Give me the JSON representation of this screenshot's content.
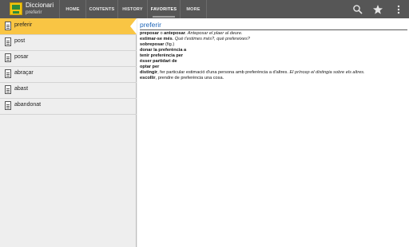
{
  "app": {
    "title": "Diccionari",
    "subtitle": "preferir"
  },
  "tabs": [
    {
      "label": "HOME"
    },
    {
      "label": "CONTENTS"
    },
    {
      "label": "HISTORY"
    },
    {
      "label": "FAVORITES"
    },
    {
      "label": "MORE"
    }
  ],
  "active_tab": "FAVORITES",
  "action_icons": [
    "search-icon",
    "star-icon",
    "overflow-menu-icon"
  ],
  "colors": {
    "action_bar": "#565656",
    "selected_row": "#f9c544",
    "entry_title": "#1f66b8"
  },
  "favorites": [
    {
      "word": "preferir",
      "selected": true
    },
    {
      "word": "post",
      "selected": false
    },
    {
      "word": "posar",
      "selected": false
    },
    {
      "word": "abraçar",
      "selected": false
    },
    {
      "word": "abast",
      "selected": false
    },
    {
      "word": "abandonat",
      "selected": false
    }
  ],
  "entry": {
    "headword": "preferir",
    "lines": [
      {
        "bold": "preposar",
        "text": " o ",
        "bold2": "anteposar",
        "italic": ". Anteposar el plaer al deure."
      },
      {
        "bold": "estimar-se més",
        "text": ". ",
        "bold2": "",
        "italic": "Què t'estimes més?, què prefereixes?"
      },
      {
        "bold": "sobreposar",
        "text": " (fig.)",
        "bold2": "",
        "italic": ""
      },
      {
        "bold": "donar la preferència a",
        "text": "",
        "bold2": "",
        "italic": ""
      },
      {
        "bold": "tenir preferència per",
        "text": "",
        "bold2": "",
        "italic": ""
      },
      {
        "bold": "ésser partidari de",
        "text": "",
        "bold2": "",
        "italic": ""
      },
      {
        "bold": "optar per",
        "text": "",
        "bold2": "",
        "italic": ""
      },
      {
        "bold": "distingir",
        "text": ", fer particular estimació d'una persona amb preferència a d'altres. ",
        "bold2": "",
        "italic": "El príncep el distingia sobre els altres."
      },
      {
        "bold": "escollir",
        "text": ", prendre de preferència una cosa.",
        "bold2": "",
        "italic": ""
      }
    ]
  }
}
